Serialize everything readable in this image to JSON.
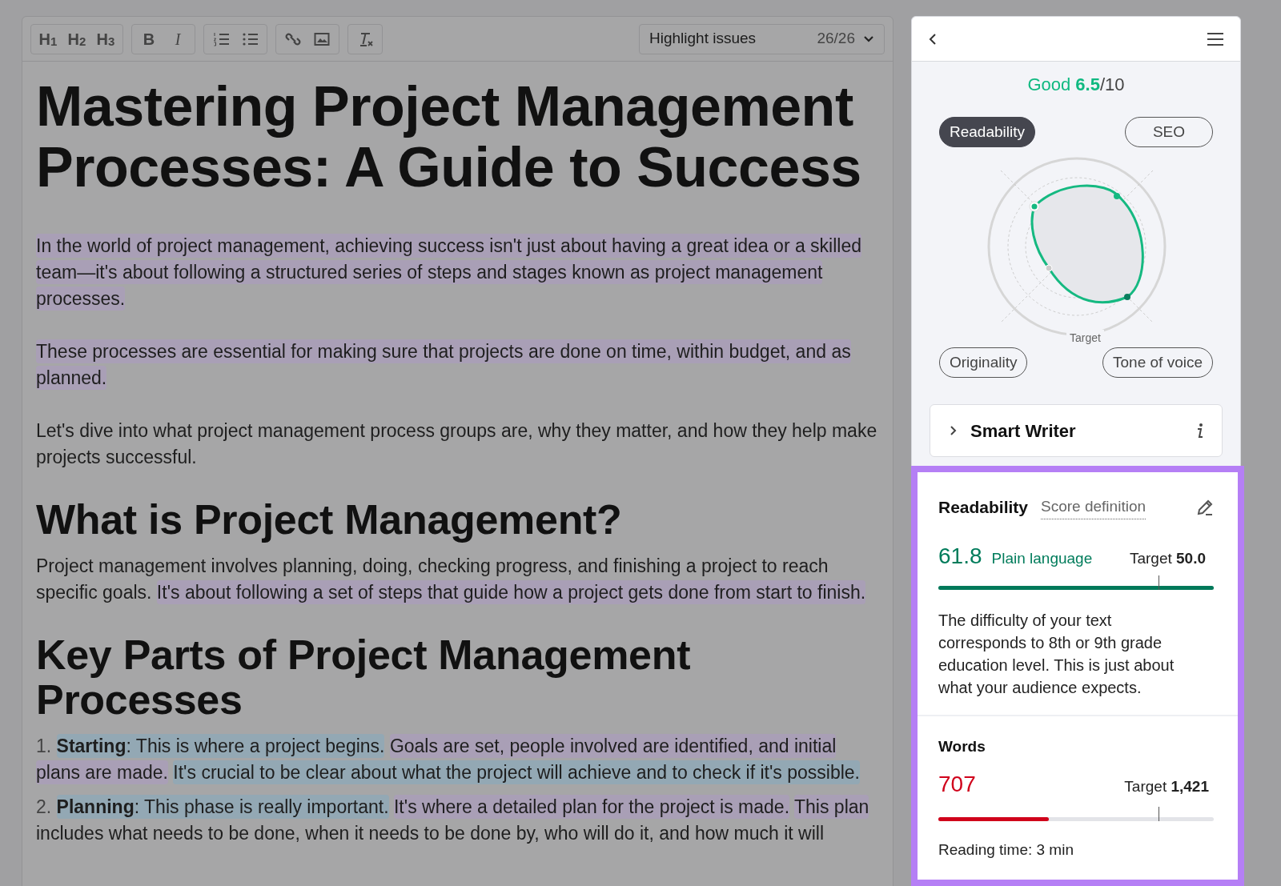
{
  "toolbar": {
    "groups": [
      [
        {
          "kind": "text",
          "label": "H$_{1}$"
        },
        {
          "kind": "text",
          "label": "H$_{2}$"
        },
        {
          "kind": "text",
          "label": "H$_{3}$"
        }
      ],
      [
        {
          "kind": "bold",
          "label": "B"
        },
        {
          "kind": "italic",
          "label": "I"
        }
      ],
      [
        {
          "kind": "ordered-list"
        },
        {
          "kind": "bullet-list"
        }
      ],
      [
        {
          "kind": "link"
        },
        {
          "kind": "image"
        }
      ],
      [
        {
          "kind": "clear-format"
        }
      ]
    ],
    "highlight": {
      "label": "Highlight issues",
      "count": "26/26"
    }
  },
  "document": [
    {
      "kind": "h1",
      "text": "Mastering Project Management Processes: A Guide to Success"
    },
    {
      "kind": "p",
      "segments": [
        {
          "text": "In the world of project management, achieving success isn't just about having a great idea or a skilled team—it's about following a structured series of steps and stages known as project management processes.",
          "color": "#a99fb6"
        }
      ]
    },
    {
      "kind": "p",
      "segments": [
        {
          "text": "These processes are essential for making sure that projects are done on time, within budget, and as planned.",
          "color": "#a99fb6"
        }
      ]
    },
    {
      "kind": "p",
      "segments": [
        {
          "text": "Let's dive into what project management process groups are, why they matter, and how they help make projects successful."
        }
      ]
    },
    {
      "kind": "h2",
      "text": "What is Project Management?"
    },
    {
      "kind": "p",
      "segments": [
        {
          "text": "Project management involves planning, doing, checking progress, and finishing a project to reach specific goals."
        },
        {
          "text": "It's about following a set of steps that guide how a project gets done from start to finish.",
          "color": "#a99fb6"
        }
      ]
    },
    {
      "kind": "h2",
      "text": "Key Parts of Project Management Processes"
    },
    {
      "kind": "li",
      "number": "1.",
      "segments": [
        {
          "text": "**Starting**: This is where a project begins.",
          "color": "#93a8b4"
        },
        {
          "text": "Goals are set, people involved are identified, and initial plans are made.",
          "color": "#a99fb6"
        },
        {
          "text": "It's crucial to be clear about what the project will achieve and to check if it's possible.",
          "color": "#93a8b4"
        }
      ]
    },
    {
      "kind": "li",
      "number": "2.",
      "segments": [
        {
          "text": "**Planning**: This phase is really important.",
          "color": "#93a8b4"
        },
        {
          "text": "It's where a detailed plan for the project is made.",
          "color": "#a99fb6"
        },
        {
          "text": "This plan",
          "color": "#a99fb6"
        },
        {
          "text": "includes what needs to be done, when it needs to be done by, who will do it, and how much it will"
        }
      ]
    }
  ],
  "panel": {
    "score": {
      "label": "Good",
      "value": "6.5",
      "out_of": "/10"
    },
    "tabs": [
      {
        "label": "Readability",
        "selected": true
      },
      {
        "label": "SEO",
        "selected": false
      },
      {
        "label": "Originality",
        "selected": false
      },
      {
        "label": "Tone of voice",
        "selected": false
      }
    ],
    "target_label": "Target",
    "smart_writer": {
      "label": "Smart Writer",
      "expanded": false
    },
    "readability": {
      "title": "Readability",
      "link": "Score definition",
      "value": "61.8",
      "grade": "Plain language",
      "target": "Target **50.0**",
      "level": 1,
      "description": "The difficulty of your text corresponds to 8th or 9th grade education level. This is just about what your audience expects."
    },
    "words": {
      "title": "Words",
      "value": "707",
      "target": "Target **1,421**",
      "level": 0.4,
      "reading_time": "Reading time: 3 min"
    }
  }
}
